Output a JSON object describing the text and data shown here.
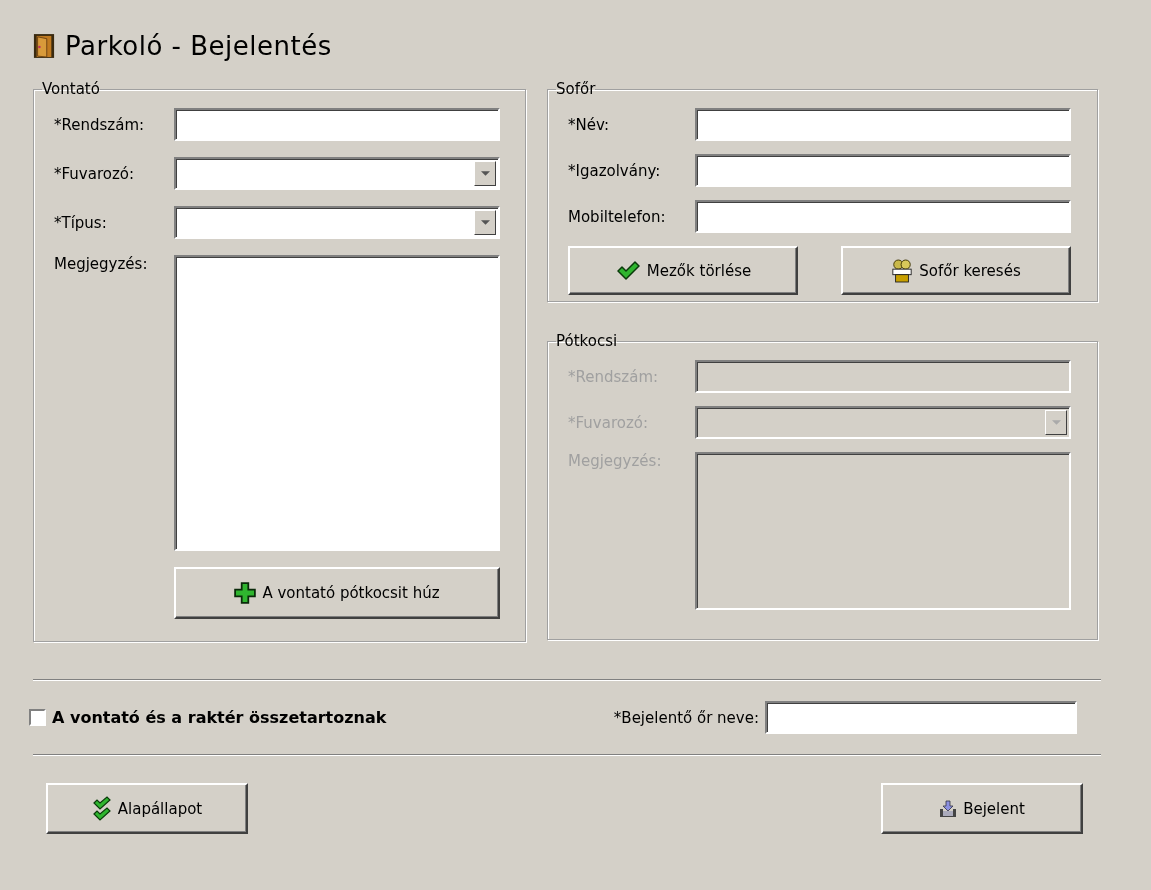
{
  "title": "Parkoló - Bejelentés",
  "tractor": {
    "legend": "Vontató",
    "fields": [
      {
        "kind": "text",
        "label": "*Rendszám:"
      },
      {
        "kind": "dropdown",
        "label": "*Fuvarozó:"
      },
      {
        "kind": "dropdown",
        "label": "*Típus:"
      },
      {
        "kind": "textarea",
        "label": "Megjegyzés:"
      }
    ],
    "button": "A vontató pótkocsit húz"
  },
  "driver": {
    "legend": "Sofőr",
    "fields": [
      {
        "kind": "text",
        "label": "*Név:"
      },
      {
        "kind": "text",
        "label": "*Igazolvány:"
      },
      {
        "kind": "text",
        "label": "Mobiltelefon:"
      }
    ],
    "buttons": [
      "Mezők törlése",
      "Sofőr keresés"
    ]
  },
  "trailer": {
    "legend": "Pótkocsi",
    "disabled": true,
    "fields": [
      {
        "kind": "text",
        "label": "*Rendszám:"
      },
      {
        "kind": "dropdown",
        "label": "*Fuvarozó:"
      },
      {
        "kind": "textarea",
        "label": "Megjegyzés:"
      }
    ]
  },
  "together": {
    "label": "A vontató és a raktér összetartoznak",
    "checked": false
  },
  "reporter": {
    "label": "*Bejelentő őr neve:"
  },
  "buttons": [
    "Alapállapot",
    "Bejelent"
  ]
}
